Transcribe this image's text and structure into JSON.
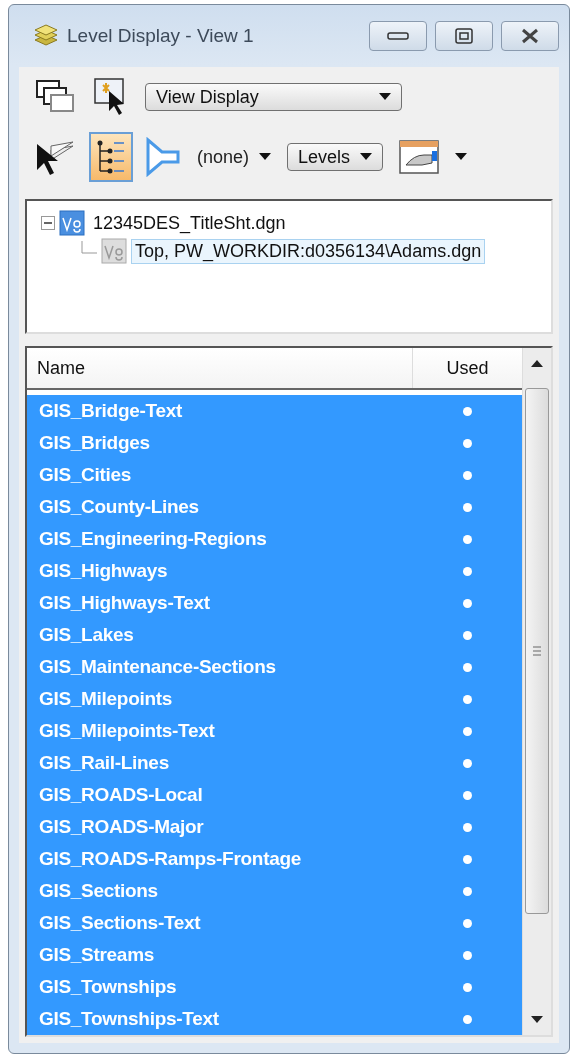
{
  "window": {
    "title": "Level Display - View 1"
  },
  "toolbar": {
    "view_dropdown": "View Display",
    "filter": "(none)",
    "mode_dropdown": "Levels",
    "tree_toggle": {
      "selected": true
    }
  },
  "tree": [
    {
      "label": "12345DES_TitleSht.dgn",
      "expanded": true,
      "children": [
        {
          "label": "Top, PW_WORKDIR:d0356134\\Adams.dgn",
          "selected": true
        }
      ]
    }
  ],
  "table": {
    "columns": [
      "Name",
      "Used"
    ],
    "rows": [
      {
        "name": "GIS_Bridge-Text",
        "used": true,
        "selected": true
      },
      {
        "name": "GIS_Bridges",
        "used": true,
        "selected": true
      },
      {
        "name": "GIS_Cities",
        "used": true,
        "selected": true
      },
      {
        "name": "GIS_County-Lines",
        "used": true,
        "selected": true
      },
      {
        "name": "GIS_Engineering-Regions",
        "used": true,
        "selected": true
      },
      {
        "name": "GIS_Highways",
        "used": true,
        "selected": true
      },
      {
        "name": "GIS_Highways-Text",
        "used": true,
        "selected": true
      },
      {
        "name": "GIS_Lakes",
        "used": true,
        "selected": true
      },
      {
        "name": "GIS_Maintenance-Sections",
        "used": true,
        "selected": true
      },
      {
        "name": "GIS_Milepoints",
        "used": true,
        "selected": true
      },
      {
        "name": "GIS_Milepoints-Text",
        "used": true,
        "selected": true
      },
      {
        "name": "GIS_Rail-Lines",
        "used": true,
        "selected": true
      },
      {
        "name": "GIS_ROADS-Local",
        "used": true,
        "selected": true
      },
      {
        "name": "GIS_ROADS-Major",
        "used": true,
        "selected": true
      },
      {
        "name": "GIS_ROADS-Ramps-Frontage",
        "used": true,
        "selected": true
      },
      {
        "name": "GIS_Sections",
        "used": true,
        "selected": true
      },
      {
        "name": "GIS_Sections-Text",
        "used": true,
        "selected": true
      },
      {
        "name": "GIS_Streams",
        "used": true,
        "selected": true
      },
      {
        "name": "GIS_Townships",
        "used": true,
        "selected": true
      },
      {
        "name": "GIS_Townships-Text",
        "used": true,
        "selected": true
      }
    ]
  }
}
